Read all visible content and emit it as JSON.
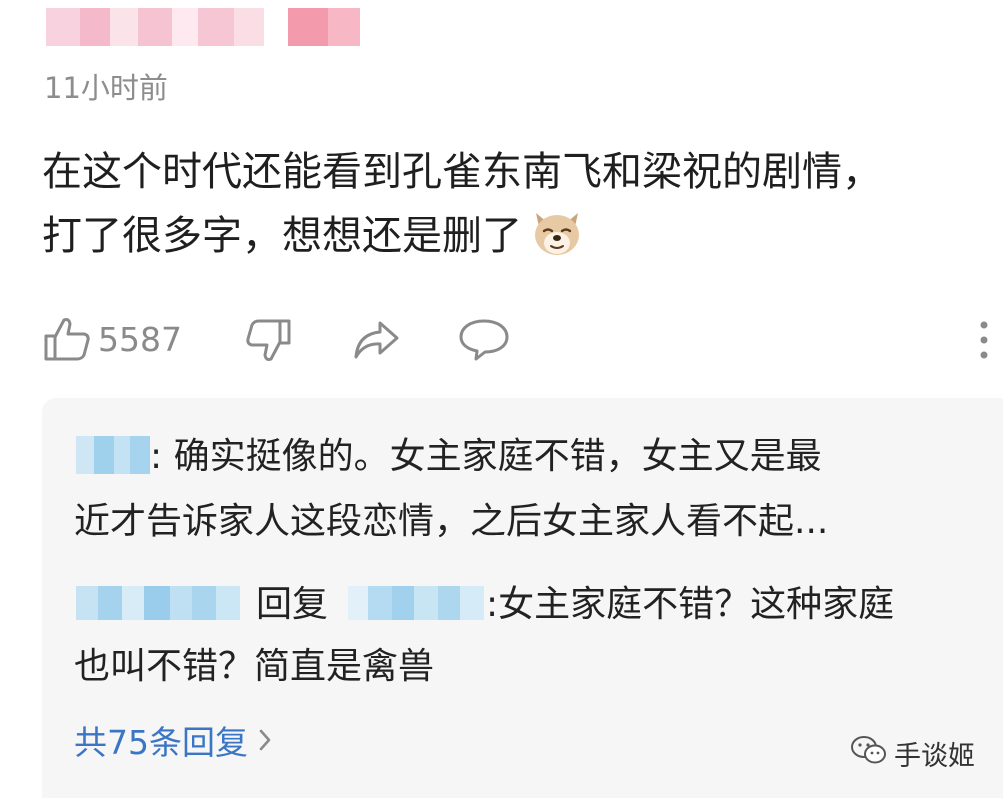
{
  "comment": {
    "timestamp": "11小时前",
    "text_line1": "在这个时代还能看到孔雀东南飞和梁祝的剧情，",
    "text_line2": "打了很多字，想想还是删了",
    "emoji": "dog-emoji"
  },
  "actions": {
    "like_count": "5587"
  },
  "replies": {
    "reply1_line1": ": 确实挺像的。女主家庭不错，女主又是最",
    "reply1_line2": "近才告诉家人这段恋情，之后女主家人看不起...",
    "reply2_reply_word": "回复",
    "reply2_line1": ":女主家庭不错？这种家庭",
    "reply2_line2": "也叫不错？简直是禽兽",
    "total_label": "共75条回复"
  },
  "watermark": {
    "text": "手谈姬"
  },
  "colors": {
    "link_blue": "#3b76c4",
    "reply_background": "#f6f6f6",
    "blur_pink": "#f7c9d6",
    "blur_blue": "#a9d6ef"
  }
}
